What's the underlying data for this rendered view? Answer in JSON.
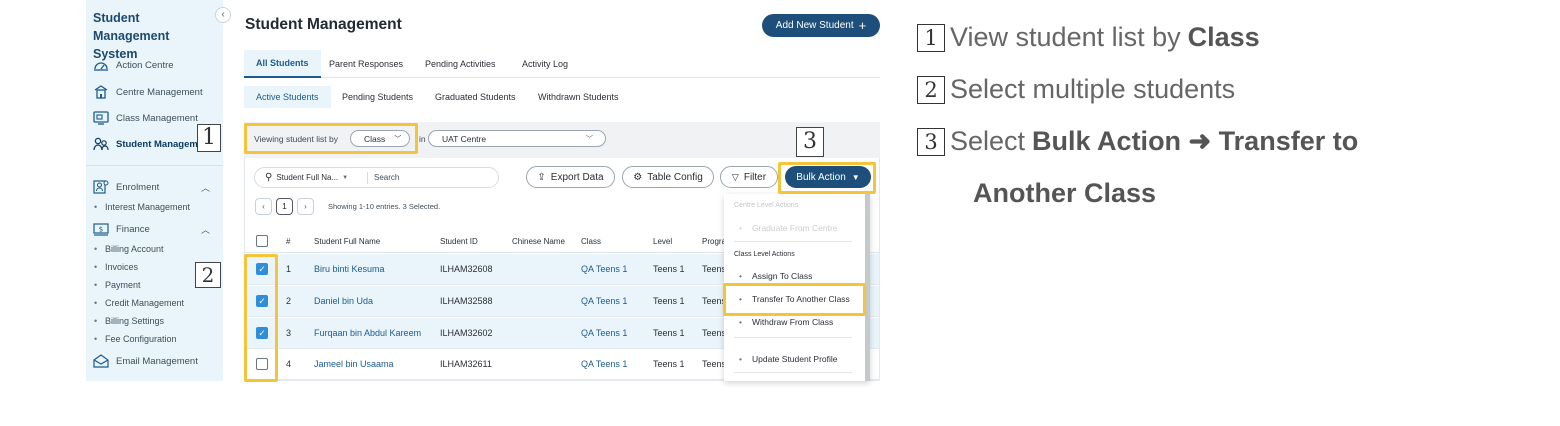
{
  "sidebar": {
    "brand": "Student Management System",
    "collapse_icon": "chevron-left-icon",
    "items": [
      {
        "label": "Action Centre",
        "icon": "gauge-icon"
      },
      {
        "label": "Centre Management",
        "icon": "building-icon"
      },
      {
        "label": "Class Management",
        "icon": "board-icon"
      },
      {
        "label": "Student Management",
        "icon": "users-icon",
        "active": true
      },
      {
        "label": "Enrolment",
        "icon": "enrolment-icon"
      },
      {
        "label": "Finance",
        "icon": "money-icon"
      },
      {
        "label": "Email Management",
        "icon": "mail-icon"
      }
    ],
    "enrolment_sub": [
      "Interest Management"
    ],
    "finance_sub": [
      "Billing Account",
      "Invoices",
      "Payment",
      "Credit Management",
      "Billing Settings",
      "Fee Configuration"
    ]
  },
  "main": {
    "title": "Student Management",
    "add_button": "Add New Student",
    "tabs": [
      "All Students",
      "Parent Responses",
      "Pending Activities",
      "Activity Log"
    ],
    "sub_tabs": [
      "Active Students",
      "Pending Students",
      "Graduated Students",
      "Withdrawn Students"
    ],
    "filter": {
      "label": "Viewing student list by",
      "class_value": "Class",
      "in_label": "in",
      "centre_value": "UAT Centre"
    },
    "search": {
      "field": "Student Full Na...",
      "placeholder": "Search"
    },
    "buttons": {
      "export": "Export Data",
      "config": "Table Config",
      "filter": "Filter",
      "bulk": "Bulk Action"
    },
    "pager": {
      "prev": "‹",
      "page": "1",
      "next": "›",
      "info": "Showing 1-10 entries. 3 Selected."
    },
    "table": {
      "headers": [
        "#",
        "Student Full Name",
        "Student ID",
        "Chinese Name",
        "Class",
        "Level",
        "Progra"
      ],
      "rows": [
        {
          "n": "1",
          "name": "Biru binti Kesuma",
          "id": "ILHAM32608",
          "cls": "QA Teens 1",
          "level": "Teens 1",
          "prog": "Teens",
          "checked": true
        },
        {
          "n": "2",
          "name": "Daniel bin Uda",
          "id": "ILHAM32588",
          "cls": "QA Teens 1",
          "level": "Teens 1",
          "prog": "Teens",
          "checked": true
        },
        {
          "n": "3",
          "name": "Furqaan bin Abdul Kareem",
          "id": "ILHAM32602",
          "cls": "QA Teens 1",
          "level": "Teens 1",
          "prog": "Teens",
          "checked": true
        },
        {
          "n": "4",
          "name": "Jameel bin Usaama",
          "id": "ILHAM32611",
          "cls": "QA Teens 1",
          "level": "Teens 1",
          "prog": "Teens",
          "checked": false
        }
      ]
    },
    "bulk_menu": {
      "centre_header": "Centre Level Actions",
      "centre_items": [
        "Graduate From Centre"
      ],
      "class_header": "Class Level Actions",
      "class_items": [
        "Assign To Class",
        "Transfer To Another Class",
        "Withdraw From Class"
      ],
      "other_items": [
        "Update Student Profile"
      ]
    }
  },
  "callouts": [
    "1",
    "2",
    "3"
  ],
  "instructions": {
    "step1": {
      "num": "1",
      "text": "View student list by ",
      "bold": "Class"
    },
    "step2": {
      "num": "2",
      "text": "Select multiple students"
    },
    "step3": {
      "num": "3",
      "text": "Select ",
      "bold": "Bulk Action ➜ Transfer to",
      "bold2": "Another Class"
    }
  },
  "colors": {
    "highlight": "#f4c53a",
    "primary": "#1d4f7a",
    "sidebar_bg": "#e9f5fb"
  }
}
